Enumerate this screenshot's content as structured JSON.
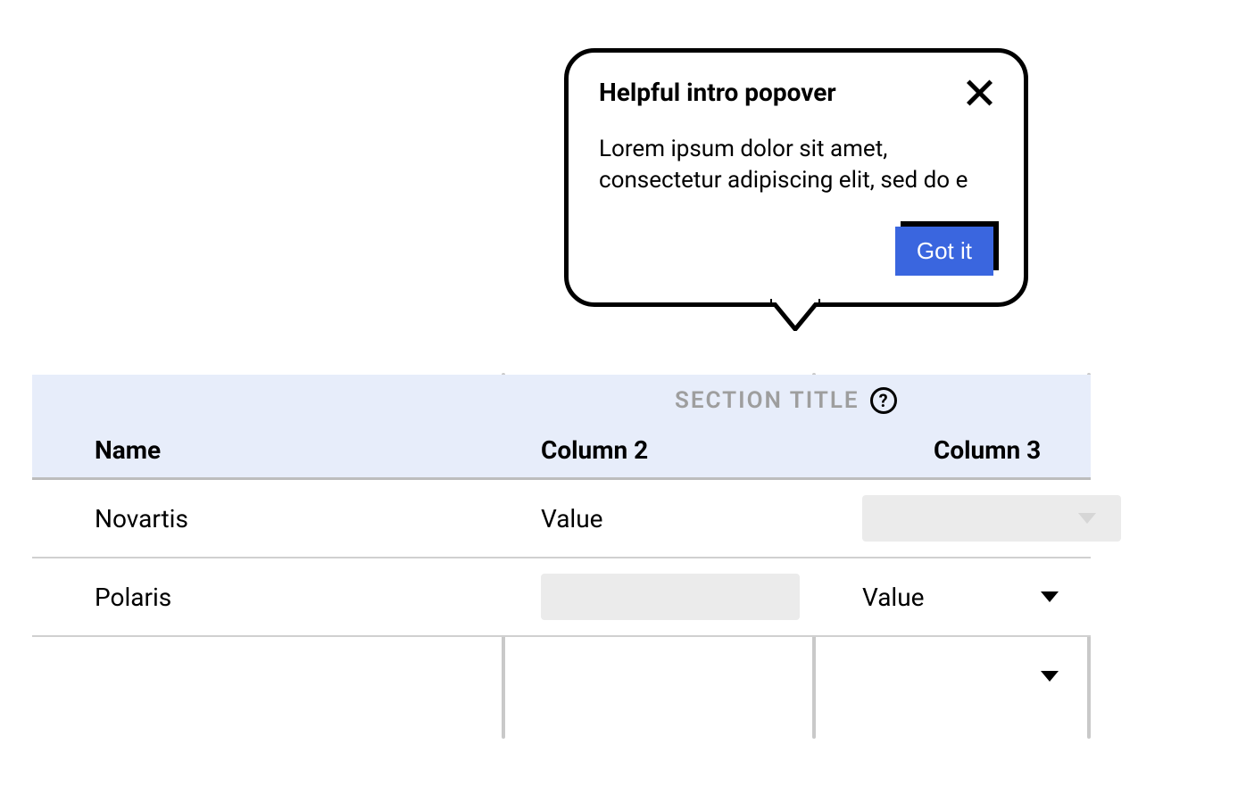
{
  "popover": {
    "title": "Helpful intro popover",
    "body": "Lorem ipsum dolor sit amet, consectetur adipiscing elit, sed do e",
    "confirm_label": "Got it"
  },
  "table": {
    "section_title": "SECTION TITLE",
    "columns": {
      "name": "Name",
      "col2": "Column 2",
      "col3": "Column 3"
    },
    "rows": [
      {
        "name": "Novartis",
        "col2": "Value",
        "col3": ""
      },
      {
        "name": "Polaris",
        "col2": "",
        "col3": "Value"
      }
    ]
  }
}
